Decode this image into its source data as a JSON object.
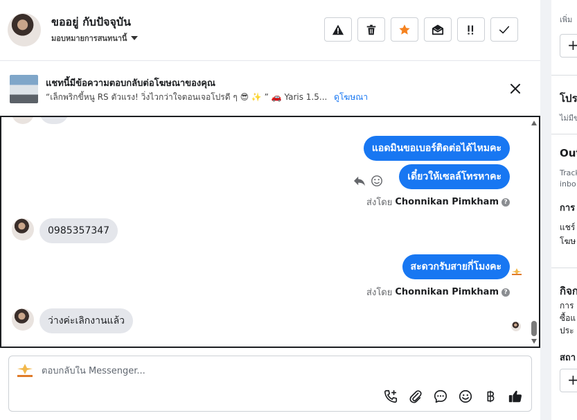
{
  "header": {
    "name": "ขออยู่ กับปัจจุบัน",
    "assign_label": "มอบหมายการสนทนานี้",
    "toolbar_icons": [
      "alert-icon",
      "trash-icon",
      "star-icon",
      "mark-unread-icon",
      "priority-icon",
      "check-icon"
    ],
    "star_color": "#f5821f"
  },
  "ad_banner": {
    "title": "แชทนี้มีข้อความตอบกลับต่อโฆษณาของคุณ",
    "text": "“เล็กพริกขี้หนู RS ตัวแรง! วิ่งไวกว่าใจตอนเจอโปรดี ๆ 😎 ✨ ” 🚗 Yaris 1.5...",
    "link": "ดูโฆษณา"
  },
  "messages": [
    {
      "dir": "out",
      "text": "แอดมินขอเบอร์ติดต่อได้ไหมคะ"
    },
    {
      "dir": "out",
      "text": "เดี๋ยวให้เซลล์โทรหาคะ"
    },
    {
      "dir": "meta",
      "sent_by_label": "ส่งโดย",
      "sender": "Chonnikan Pimkham"
    },
    {
      "dir": "in",
      "text": "0985357347"
    },
    {
      "dir": "out",
      "text": "สะดวกรับสายกี่โมงคะ"
    },
    {
      "dir": "meta",
      "sent_by_label": "ส่งโดย",
      "sender": "Chonnikan Pimkham"
    },
    {
      "dir": "in",
      "text": "ว่างค่ะเลิกงานแล้ว"
    }
  ],
  "composer": {
    "placeholder": "ตอบกลับใน Messenger...",
    "icons": [
      "call-add-icon",
      "paperclip-icon",
      "chat-bubble-icon",
      "emoji-icon",
      "baht-icon",
      "thumbs-up-icon"
    ]
  },
  "right_panel": {
    "add_label_text": "เพิ่ม",
    "section_1": "โปร",
    "section_1_sub": "ไม่มีข",
    "section_2": "Out",
    "section_2_body_1": "Track",
    "section_2_body_2": "inbo",
    "section_2_sub": "การ",
    "section_2_item_1": "แชร์",
    "section_2_item_2": "โฆษ",
    "section_3": "กิจก",
    "section_3_body_1": "การ",
    "section_3_body_2": "ซื้อแ",
    "section_3_body_3": "ประ",
    "section_4": "สถา",
    "plus": "+"
  },
  "colors": {
    "accent": "#1877f2",
    "bubble_in": "#e4e6eb",
    "panel_bg": "#f0f2f5"
  }
}
